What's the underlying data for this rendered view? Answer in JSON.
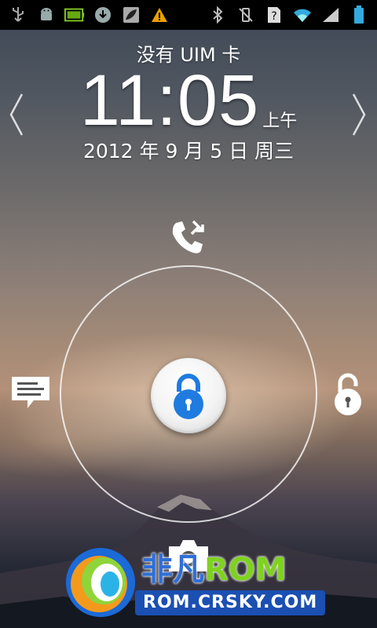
{
  "status_bar": {
    "left_icons": [
      "usb-icon",
      "android-debug-icon",
      "battery-level-icon",
      "download-icon",
      "leaf-notification-icon",
      "warning-icon"
    ],
    "right_icons": [
      "bluetooth-icon",
      "vibrate-icon",
      "sim-unknown-icon",
      "wifi-icon",
      "signal-icon",
      "battery-icon"
    ]
  },
  "lockscreen": {
    "carrier": "没有 UIM 卡",
    "time": "11:05",
    "ampm": "上午",
    "date": "2012 年 9 月 5 日 周三"
  },
  "targets": [
    "phone-icon",
    "message-icon",
    "unlock-icon",
    "camera-icon"
  ],
  "watermark": {
    "title_cn": "非凡",
    "title_rom": "ROM",
    "url": "ROM.CRSKY.COM"
  },
  "colors": {
    "status_bar_bg": "#000000",
    "lock_blue": "#1f7be0",
    "watermark_blue": "#2e6fd8",
    "watermark_green": "#7fd21f"
  }
}
